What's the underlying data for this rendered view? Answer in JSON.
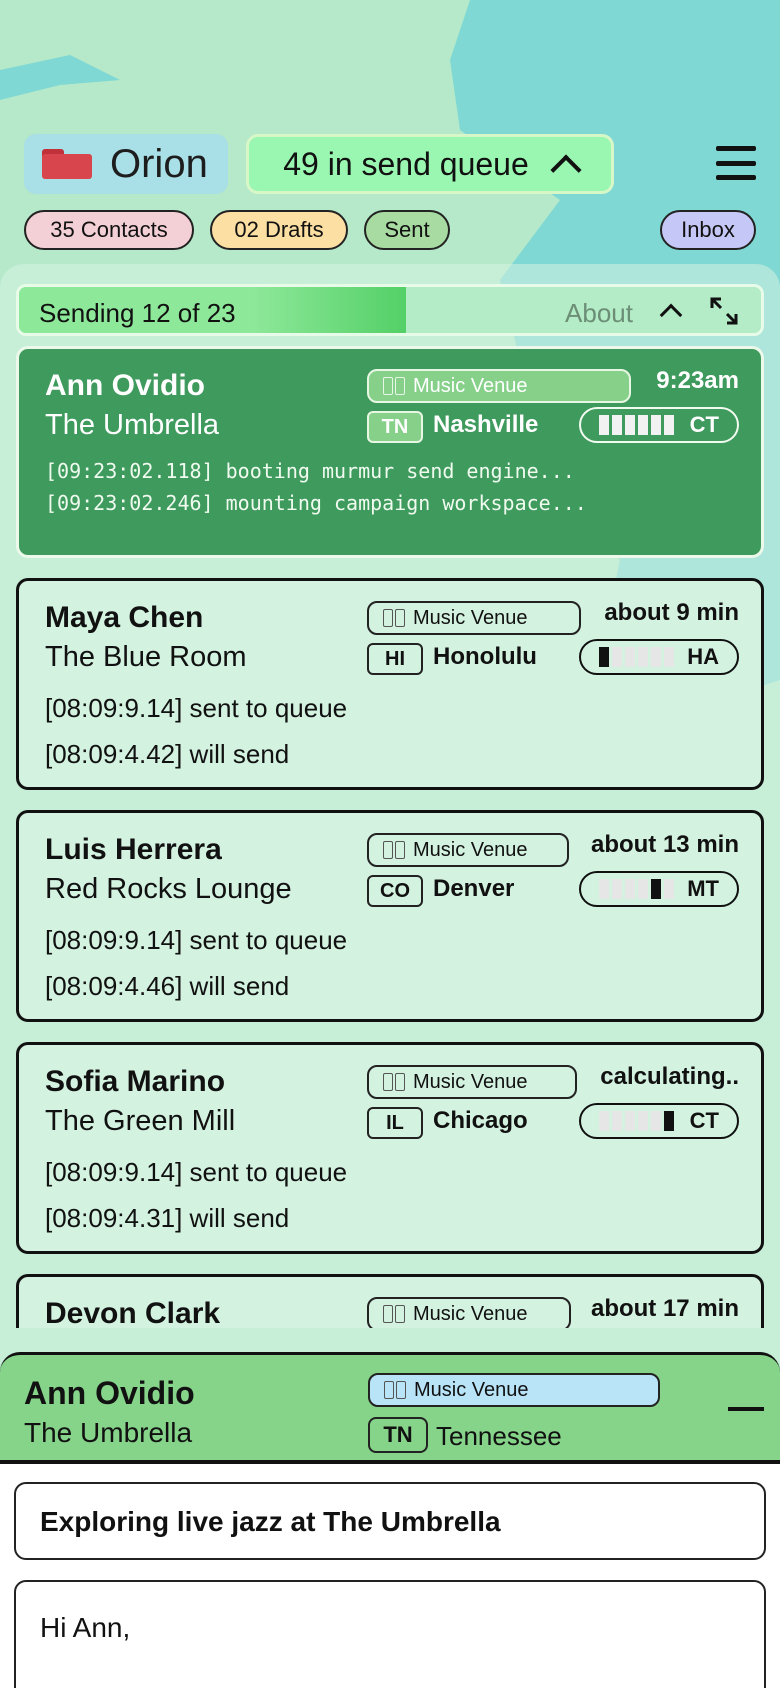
{
  "app": {
    "name": "Orion",
    "queue_label": "49 in send queue"
  },
  "filters": [
    {
      "label": "35 Contacts",
      "color": "#f3cfd6"
    },
    {
      "label": "02 Drafts",
      "color": "#fbdfa3"
    },
    {
      "label": "Sent",
      "color": "#a8dba2"
    },
    {
      "label": "Inbox",
      "color": "#c5c8f7"
    }
  ],
  "progress": {
    "label": "Sending 12 of 23",
    "fraction": 0.5217,
    "about_label": "About"
  },
  "queue": [
    {
      "name": "Ann Ovidio",
      "company": "The Umbrella",
      "tag": "Music Venue",
      "time": "9:23am",
      "state": "TN",
      "city": "Nashville",
      "tz": "CT",
      "tz_active_segment": 5,
      "active": true,
      "logs": [
        "[09:23:02.118] booting murmur send engine...",
        "[09:23:02.246] mounting campaign workspace..."
      ]
    },
    {
      "name": "Maya Chen",
      "company": "The Blue Room",
      "tag": "Music Venue",
      "time": "about 9 min",
      "state": "HI",
      "city": "Honolulu",
      "tz": "HA",
      "tz_active_segment": 0,
      "active": false,
      "logs": [
        "[08:09:9.14] sent to queue",
        "[08:09:4.42] will send"
      ]
    },
    {
      "name": "Luis Herrera",
      "company": "Red Rocks Lounge",
      "tag": "Music Venue",
      "time": "about 13 min",
      "state": "CO",
      "city": "Denver",
      "tz": "MT",
      "tz_active_segment": 4,
      "active": false,
      "logs": [
        "[08:09:9.14] sent to queue",
        "[08:09:4.46] will send"
      ]
    },
    {
      "name": "Sofia Marino",
      "company": "The Green Mill",
      "tag": "Music Venue",
      "time": "calculating..",
      "state": "IL",
      "city": "Chicago",
      "tz": "CT",
      "tz_active_segment": 5,
      "active": false,
      "logs": [
        "[08:09:9.14] sent to queue",
        "[08:09:4.31] will send"
      ]
    },
    {
      "name": "Devon Clark",
      "company": "",
      "tag": "Music Venue",
      "time": "about 17 min",
      "state": "",
      "city": "",
      "tz": "",
      "tz_active_segment": -1,
      "active": false,
      "logs": []
    }
  ],
  "composer": {
    "name": "Ann Ovidio",
    "company": "The Umbrella",
    "tag": "Music Venue",
    "state": "TN",
    "region": "Tennessee",
    "subject": "Exploring live jazz at The Umbrella",
    "message": "Hi Ann,"
  },
  "colors": {
    "accent": "#3f9a5d",
    "background": "#b5e9c9",
    "queue_chip": "#9af7b1",
    "composer_header": "#86d38a"
  }
}
